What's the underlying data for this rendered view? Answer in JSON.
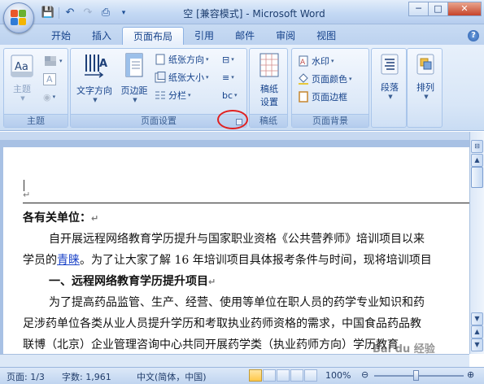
{
  "window": {
    "title": "空 [兼容模式] - Microsoft Word",
    "controls": {
      "minimize": "─",
      "maximize": "□",
      "close": "✕"
    }
  },
  "qat": {
    "save_icon": "💾",
    "undo_icon": "↶",
    "redo_icon": "↷",
    "print_icon": "⎙",
    "more_icon": "▾"
  },
  "tabs": [
    {
      "label": "开始"
    },
    {
      "label": "插入"
    },
    {
      "label": "页面布局",
      "active": true
    },
    {
      "label": "引用"
    },
    {
      "label": "邮件"
    },
    {
      "label": "审阅"
    },
    {
      "label": "视图"
    }
  ],
  "help_label": "?",
  "ribbon": {
    "theme_group": {
      "label": "主题",
      "theme_btn": "主题",
      "colors_icon": "■",
      "fonts_label": "A",
      "effects_icon": "◉"
    },
    "page_setup_group": {
      "label": "页面设置",
      "text_direction": "文字方向",
      "margins": "页边距",
      "orientation": "纸张方向",
      "size": "纸张大小",
      "columns": "分栏",
      "breaks_icon": "⊟",
      "line_numbers_icon": "≡",
      "hyphenation_label": "bc"
    },
    "manuscript_group": {
      "label": "稿纸",
      "btn": "稿纸\n设置",
      "line1": "稿纸",
      "line2": "设置"
    },
    "background_group": {
      "label": "页面背景",
      "watermark": "水印",
      "page_color": "页面颜色",
      "page_border": "页面边框"
    },
    "paragraph_btn": "段落",
    "arrange_btn": "排列"
  },
  "document": {
    "return_mark": "↵",
    "lines": [
      {
        "text": "各有关单位：",
        "bold": true
      },
      {
        "text": "自开展远程网络教育学历提升与国家职业资格《公共营养师》培训项目以来"
      },
      {
        "prefix": "学员的",
        "link": "青睐",
        "suffix": "。为了让大家了解 16 年培训项目具体报考条件与时间，现将培训项目"
      },
      {
        "text": "一、远程网络教育学历提升项目",
        "bold": true
      },
      {
        "text": "为了提高药品监管、生产、经营、使用等单位在职人员的药学专业知识和药"
      },
      {
        "text": "足涉药单位各类从业人员提升学历和考取执业药师资格的需求，中国食品药品教"
      },
      {
        "text": "联博（北京）企业管理咨询中心共同开展药学类（执业药师方向）学历教育"
      }
    ]
  },
  "statusbar": {
    "page": "页面: 1/3",
    "words": "字数: 1,961",
    "language": "中文(简体，中国)",
    "zoom": "100%",
    "zoom_minus": "⊖",
    "zoom_plus": "⊕",
    "zoom_level": 1.0
  },
  "watermark_text": "Bai du 经验",
  "colors": {
    "accent": "#15428b",
    "launcher_highlight": "#e02020"
  }
}
